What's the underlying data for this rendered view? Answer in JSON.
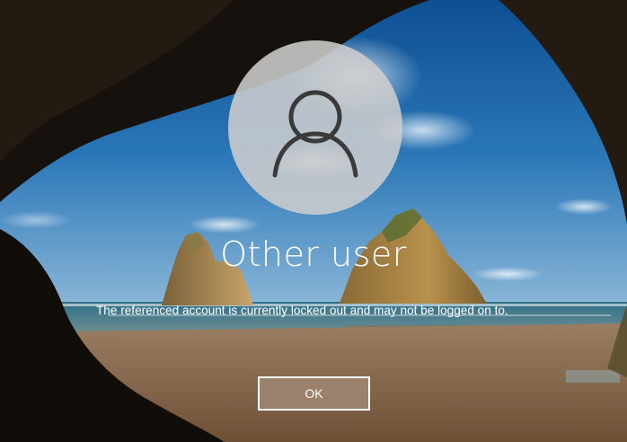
{
  "lock_screen": {
    "user_name": "Other user",
    "message": "The referenced account is currently locked out and may not be logged on to.",
    "ok_label": "OK"
  },
  "icons": {
    "avatar": "user-silhouette-icon"
  }
}
